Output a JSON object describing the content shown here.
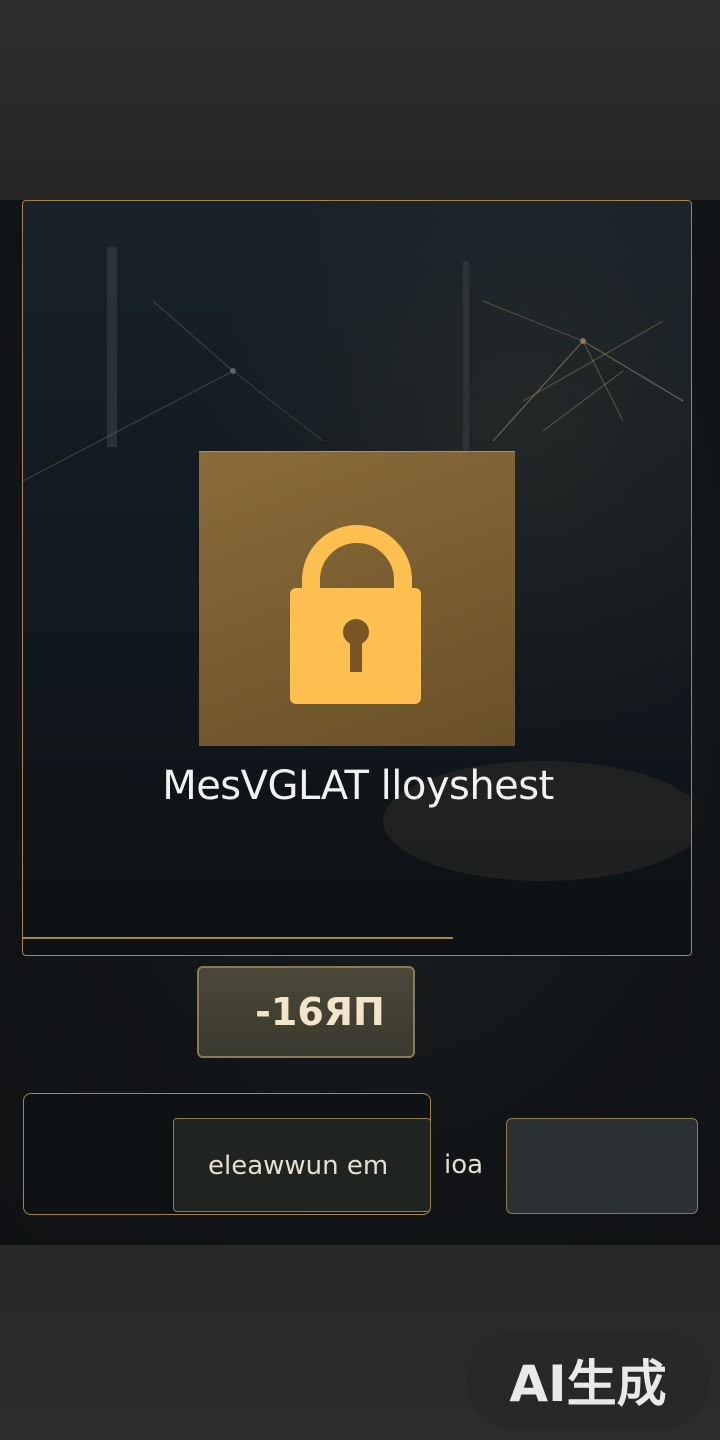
{
  "hero": {
    "app_title": "MesVGLAT lloyshest",
    "lock_icon": "padlock-icon"
  },
  "actions": {
    "primary_button_label": "-16ЯП"
  },
  "form": {
    "email_value": "eleawwun em",
    "side_label": "ioa",
    "side_field_value": ""
  },
  "badge": {
    "label": "AI生成"
  },
  "colors": {
    "accent_gold": "#a8824a",
    "lock_tile": "#7a5e31",
    "lock_icon": "#fdbf4f",
    "background": "#121518"
  }
}
